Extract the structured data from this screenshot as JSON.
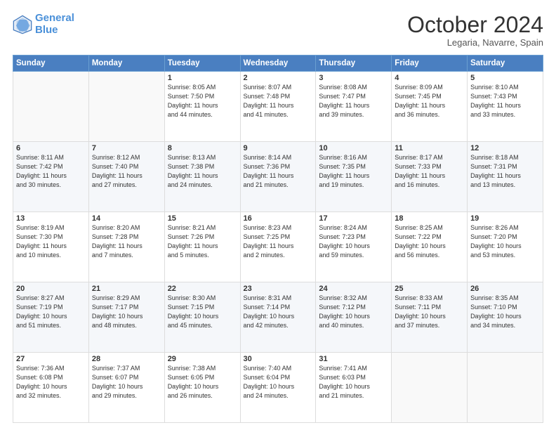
{
  "header": {
    "logo_line1": "General",
    "logo_line2": "Blue",
    "month": "October 2024",
    "location": "Legaria, Navarre, Spain"
  },
  "days_of_week": [
    "Sunday",
    "Monday",
    "Tuesday",
    "Wednesday",
    "Thursday",
    "Friday",
    "Saturday"
  ],
  "weeks": [
    [
      {
        "day": "",
        "info": ""
      },
      {
        "day": "",
        "info": ""
      },
      {
        "day": "1",
        "info": "Sunrise: 8:05 AM\nSunset: 7:50 PM\nDaylight: 11 hours\nand 44 minutes."
      },
      {
        "day": "2",
        "info": "Sunrise: 8:07 AM\nSunset: 7:48 PM\nDaylight: 11 hours\nand 41 minutes."
      },
      {
        "day": "3",
        "info": "Sunrise: 8:08 AM\nSunset: 7:47 PM\nDaylight: 11 hours\nand 39 minutes."
      },
      {
        "day": "4",
        "info": "Sunrise: 8:09 AM\nSunset: 7:45 PM\nDaylight: 11 hours\nand 36 minutes."
      },
      {
        "day": "5",
        "info": "Sunrise: 8:10 AM\nSunset: 7:43 PM\nDaylight: 11 hours\nand 33 minutes."
      }
    ],
    [
      {
        "day": "6",
        "info": "Sunrise: 8:11 AM\nSunset: 7:42 PM\nDaylight: 11 hours\nand 30 minutes."
      },
      {
        "day": "7",
        "info": "Sunrise: 8:12 AM\nSunset: 7:40 PM\nDaylight: 11 hours\nand 27 minutes."
      },
      {
        "day": "8",
        "info": "Sunrise: 8:13 AM\nSunset: 7:38 PM\nDaylight: 11 hours\nand 24 minutes."
      },
      {
        "day": "9",
        "info": "Sunrise: 8:14 AM\nSunset: 7:36 PM\nDaylight: 11 hours\nand 21 minutes."
      },
      {
        "day": "10",
        "info": "Sunrise: 8:16 AM\nSunset: 7:35 PM\nDaylight: 11 hours\nand 19 minutes."
      },
      {
        "day": "11",
        "info": "Sunrise: 8:17 AM\nSunset: 7:33 PM\nDaylight: 11 hours\nand 16 minutes."
      },
      {
        "day": "12",
        "info": "Sunrise: 8:18 AM\nSunset: 7:31 PM\nDaylight: 11 hours\nand 13 minutes."
      }
    ],
    [
      {
        "day": "13",
        "info": "Sunrise: 8:19 AM\nSunset: 7:30 PM\nDaylight: 11 hours\nand 10 minutes."
      },
      {
        "day": "14",
        "info": "Sunrise: 8:20 AM\nSunset: 7:28 PM\nDaylight: 11 hours\nand 7 minutes."
      },
      {
        "day": "15",
        "info": "Sunrise: 8:21 AM\nSunset: 7:26 PM\nDaylight: 11 hours\nand 5 minutes."
      },
      {
        "day": "16",
        "info": "Sunrise: 8:23 AM\nSunset: 7:25 PM\nDaylight: 11 hours\nand 2 minutes."
      },
      {
        "day": "17",
        "info": "Sunrise: 8:24 AM\nSunset: 7:23 PM\nDaylight: 10 hours\nand 59 minutes."
      },
      {
        "day": "18",
        "info": "Sunrise: 8:25 AM\nSunset: 7:22 PM\nDaylight: 10 hours\nand 56 minutes."
      },
      {
        "day": "19",
        "info": "Sunrise: 8:26 AM\nSunset: 7:20 PM\nDaylight: 10 hours\nand 53 minutes."
      }
    ],
    [
      {
        "day": "20",
        "info": "Sunrise: 8:27 AM\nSunset: 7:19 PM\nDaylight: 10 hours\nand 51 minutes."
      },
      {
        "day": "21",
        "info": "Sunrise: 8:29 AM\nSunset: 7:17 PM\nDaylight: 10 hours\nand 48 minutes."
      },
      {
        "day": "22",
        "info": "Sunrise: 8:30 AM\nSunset: 7:15 PM\nDaylight: 10 hours\nand 45 minutes."
      },
      {
        "day": "23",
        "info": "Sunrise: 8:31 AM\nSunset: 7:14 PM\nDaylight: 10 hours\nand 42 minutes."
      },
      {
        "day": "24",
        "info": "Sunrise: 8:32 AM\nSunset: 7:12 PM\nDaylight: 10 hours\nand 40 minutes."
      },
      {
        "day": "25",
        "info": "Sunrise: 8:33 AM\nSunset: 7:11 PM\nDaylight: 10 hours\nand 37 minutes."
      },
      {
        "day": "26",
        "info": "Sunrise: 8:35 AM\nSunset: 7:10 PM\nDaylight: 10 hours\nand 34 minutes."
      }
    ],
    [
      {
        "day": "27",
        "info": "Sunrise: 7:36 AM\nSunset: 6:08 PM\nDaylight: 10 hours\nand 32 minutes."
      },
      {
        "day": "28",
        "info": "Sunrise: 7:37 AM\nSunset: 6:07 PM\nDaylight: 10 hours\nand 29 minutes."
      },
      {
        "day": "29",
        "info": "Sunrise: 7:38 AM\nSunset: 6:05 PM\nDaylight: 10 hours\nand 26 minutes."
      },
      {
        "day": "30",
        "info": "Sunrise: 7:40 AM\nSunset: 6:04 PM\nDaylight: 10 hours\nand 24 minutes."
      },
      {
        "day": "31",
        "info": "Sunrise: 7:41 AM\nSunset: 6:03 PM\nDaylight: 10 hours\nand 21 minutes."
      },
      {
        "day": "",
        "info": ""
      },
      {
        "day": "",
        "info": ""
      }
    ]
  ]
}
